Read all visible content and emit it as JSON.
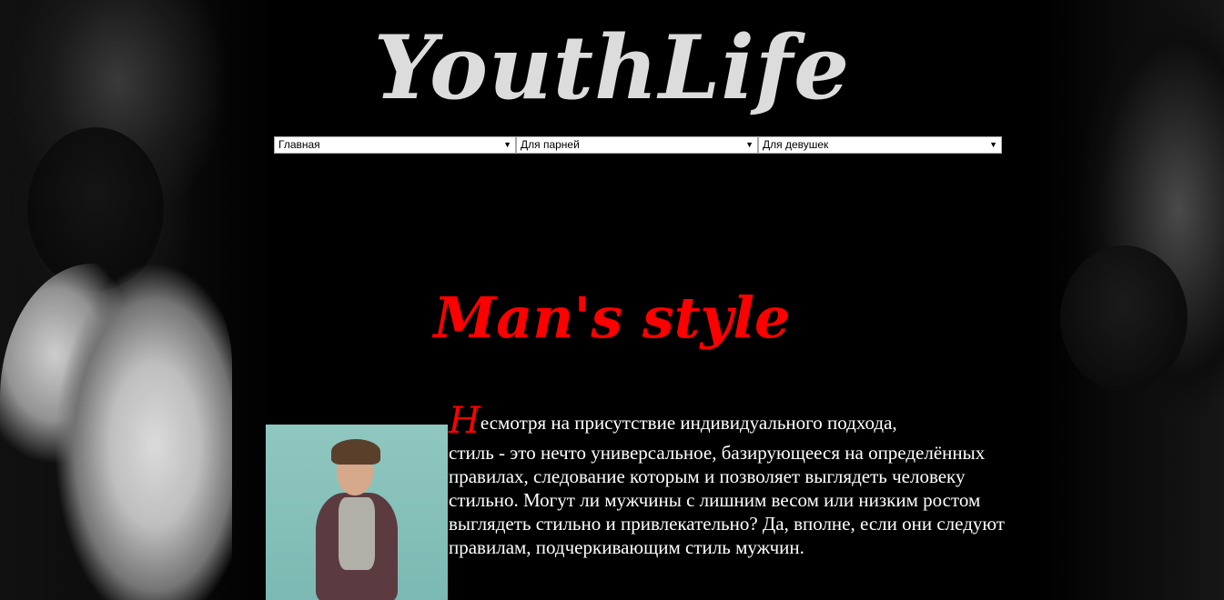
{
  "site": {
    "logo": "YouthLife"
  },
  "nav": {
    "selects": [
      {
        "selected": "Главная"
      },
      {
        "selected": "Для парней"
      },
      {
        "selected": "Для девушек"
      }
    ],
    "arrow_glyph": "▼"
  },
  "main": {
    "title": "Man's style",
    "title_color": "#ff0000",
    "dropcap": "Н",
    "first_line": "есмотря на присутствие индивидуального подхода,",
    "body": "стиль - это нечто универсальное, базирующееся на определённых правилах, следование которым и позволяет выглядеть человеку стильно. Могут ли мужчины с лишним весом или низким ростом выглядеть стильно и привлекательно? Да, вполне, если они следуют правилам, подчеркивающим стиль мужчин."
  },
  "colors": {
    "background": "#000000",
    "logo": "#dcdcdc",
    "accent": "#ff0000",
    "text": "#ffffff"
  }
}
